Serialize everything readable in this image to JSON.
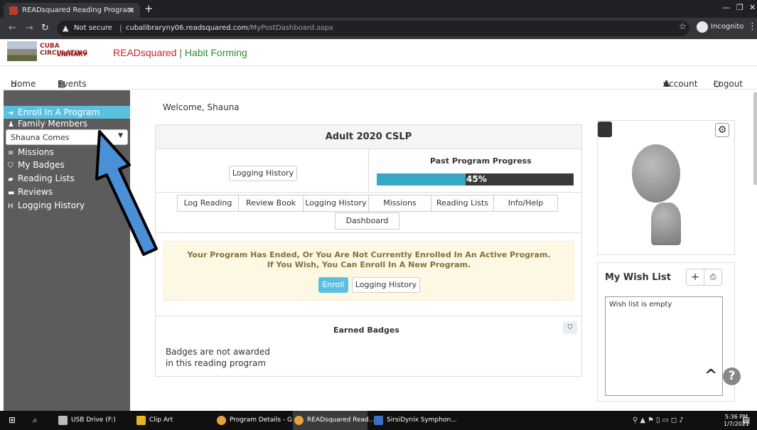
{
  "browser": {
    "tab_title": "READsquared Reading Program",
    "tab_close": "×",
    "new_tab": "+",
    "not_secure": "Not secure",
    "url_host": "cubalibraryny06.readsquared.com",
    "url_path": "/MyPostDashboard.aspx",
    "incognito": "Incognito"
  },
  "header": {
    "logo_line1": "CUBA CIRCULATING",
    "logo_line2": "LIBRARY",
    "brand_read": "READsquared",
    "brand_rest": " | Habit Forming"
  },
  "topnav": {
    "home": "Home",
    "events": "Events",
    "account": "Account",
    "logout": "Logout"
  },
  "sidebar": {
    "items": [
      {
        "label": "Enroll In A Program",
        "icon": "sign-in-icon"
      },
      {
        "label": "Family Members",
        "icon": "user-icon"
      },
      {
        "label": "Missions",
        "icon": "list-icon"
      },
      {
        "label": "My Badges",
        "icon": "shield-icon"
      },
      {
        "label": "Reading Lists",
        "icon": "book-icon"
      },
      {
        "label": "Reviews",
        "icon": "review-icon"
      },
      {
        "label": "Logging History",
        "icon": "h-icon"
      }
    ],
    "family_select": "Shauna Comes"
  },
  "main": {
    "welcome": "Welcome,  Shauna",
    "program_title": "Adult 2020 CSLP",
    "logging_history_btn": "Logging History",
    "past_progress_label": "Past Program Progress",
    "progress_pct": 45,
    "progress_text": "45%",
    "tabs": [
      "Log Reading",
      "Review Book",
      "Logging History",
      "Missions",
      "Reading Lists",
      "Info/Help"
    ],
    "dashboard_tab": "Dashboard",
    "alert_line1": "Your Program Has Ended, Or You Are Not Currently Enrolled In An Active Program.",
    "alert_line2": "If You Wish, You Can Enroll In A New Program.",
    "enroll_btn": "Enroll",
    "alert_logging_btn": "Logging History",
    "earned_title": "Earned Badges",
    "earned_msg": "Badges are not awarded in this reading program"
  },
  "wishlist": {
    "title": "My Wish List",
    "empty": "Wish list is empty"
  },
  "taskbar": {
    "items": [
      "USB Drive (F:)",
      "Clip Art",
      "Program Details - G...",
      "READsquared Read...",
      "SirsiDynix Symphon..."
    ],
    "time": "5:36 PM",
    "date": "1/7/2021"
  },
  "colors": {
    "accent": "#5bc0de",
    "sidebar": "#5c5c5c",
    "progress_fill": "#37a8c4",
    "alert_bg": "#fcf8e3",
    "arrow": "#4a90d9"
  }
}
